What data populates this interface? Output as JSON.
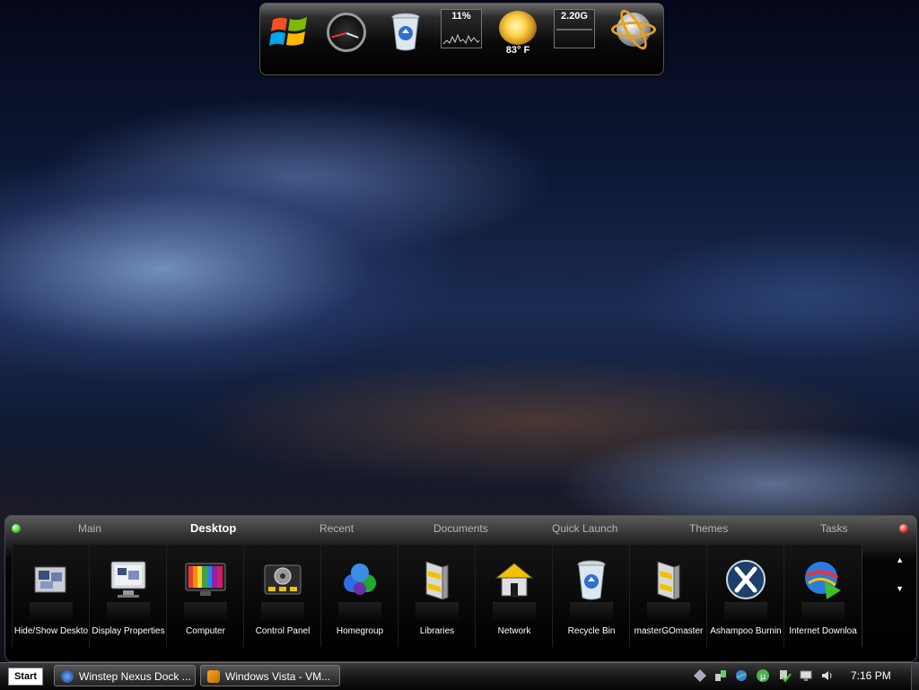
{
  "top_dock": {
    "cpu_percent": "11%",
    "weather_temp": "83° F",
    "memory": "2.20G",
    "icons": [
      "windows-logo-icon",
      "analog-clock-icon",
      "recycle-bin-icon",
      "cpu-meter-icon",
      "weather-sun-icon",
      "memory-meter-icon",
      "globe-atom-icon"
    ]
  },
  "bottom_dock": {
    "tabs": [
      {
        "label": "Main"
      },
      {
        "label": "Desktop"
      },
      {
        "label": "Recent"
      },
      {
        "label": "Documents"
      },
      {
        "label": "Quick Launch"
      },
      {
        "label": "Themes"
      },
      {
        "label": "Tasks"
      }
    ],
    "active_tab": "Desktop",
    "items": [
      {
        "label": "Hide/Show Deskto",
        "icon": "hide-show-desktop-icon"
      },
      {
        "label": "Display Properties",
        "icon": "display-properties-icon"
      },
      {
        "label": "Computer",
        "icon": "computer-monitor-icon"
      },
      {
        "label": "Control Panel",
        "icon": "control-panel-icon"
      },
      {
        "label": "Homegroup",
        "icon": "homegroup-icon"
      },
      {
        "label": "Libraries",
        "icon": "libraries-folder-icon"
      },
      {
        "label": "Network",
        "icon": "network-house-icon"
      },
      {
        "label": "Recycle Bin",
        "icon": "recycle-bin-icon"
      },
      {
        "label": "masterGOmaster",
        "icon": "folder-icon"
      },
      {
        "label": "Ashampoo Burnin",
        "icon": "ashampoo-x-icon"
      },
      {
        "label": "Internet Downloa",
        "icon": "internet-download-manager-icon"
      }
    ],
    "scroll_up": "▲",
    "scroll_down": "▼"
  },
  "taskbar": {
    "start_label": "Start",
    "tasks": [
      {
        "label": "Winstep Nexus Dock ..."
      },
      {
        "label": "Windows Vista - VM..."
      }
    ],
    "tray_icons": [
      "diamond-icon",
      "network-icon",
      "ie-sync-icon",
      "utorrent-icon",
      "safely-remove-icon",
      "display-icon",
      "volume-icon"
    ],
    "time": "7:16 PM"
  },
  "colors": {
    "accent_active_tab": "#ffffff",
    "tab_inactive": "#b4b4b4",
    "dock_bg": "#000000",
    "green_dot": "#3bd11d",
    "red_dot": "#e52a2a"
  }
}
